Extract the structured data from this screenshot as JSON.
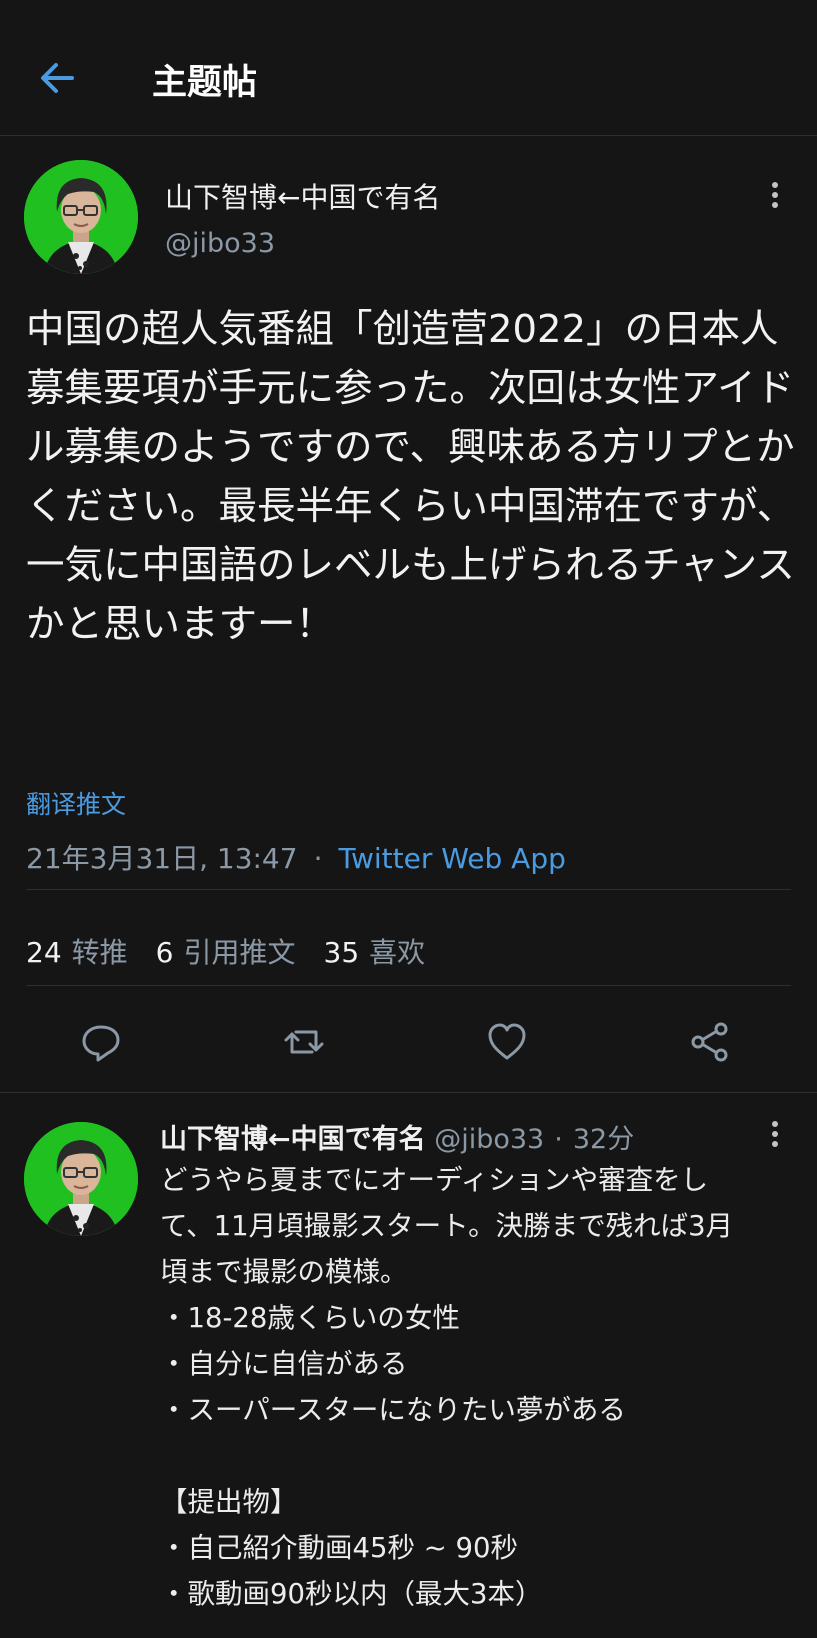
{
  "header": {
    "title": "主题帖",
    "back_icon": "arrow-left-icon"
  },
  "main_tweet": {
    "author_name": "山下智博←中国で有名",
    "handle": "@jibo33",
    "text": "中国の超人気番組「创造营2022」の日本人募集要項が手元に参った。次回は女性アイドル募集のようですので、興味ある方リプとかください。最長半年くらい中国滞在ですが、一気に中国語のレベルも上げられるチャンスかと思いますー！",
    "translate_label": "翻译推文",
    "timestamp": "21年3月31日, 13:47",
    "separator": "·",
    "source": "Twitter Web App",
    "stats": {
      "retweets_count": "24",
      "retweets_label": "转推",
      "quotes_count": "6",
      "quotes_label": "引用推文",
      "likes_count": "35",
      "likes_label": "喜欢"
    }
  },
  "actions": [
    "reply-icon",
    "retweet-icon",
    "like-icon",
    "share-icon"
  ],
  "reply_tweet": {
    "author_name": "山下智博←中国で有名",
    "handle": "@jibo33",
    "separator": "·",
    "time": "32分",
    "lines": [
      "どうやら夏までにオーディションや審査をし",
      "て、11月頃撮影スタート。決勝まで残れば3月",
      "頃まで撮影の模様。",
      "・18-28歳くらいの女性",
      "・自分に自信がある",
      "・スーパースターになりたい夢がある",
      "",
      "【提出物】",
      "・自己紹介動画45秒 ~ 90秒",
      "・歌動画90秒以内（最大3本）"
    ]
  },
  "colors": {
    "background": "#151515",
    "link": "#4a9be0",
    "avatar_bg": "#1fc01f",
    "muted": "#8b98a5"
  }
}
